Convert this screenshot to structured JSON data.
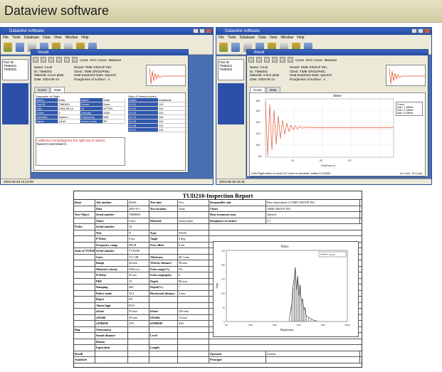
{
  "header": {
    "title": "Dataview software"
  },
  "screens": [
    {
      "app_title": "Dataview software",
      "menu": [
        "File",
        "Tools",
        "Database",
        "Data",
        "View",
        "Window",
        "Help"
      ],
      "dialog_title": "Result",
      "dialog_toolbar": [
        "Curve",
        "DAC Curve",
        "Measure"
      ],
      "info": [
        "Name:  Crust",
        "ID:  TIME001",
        "Material: Armor plate",
        "Date:  2004-06-14"
      ],
      "info_right": [
        "Result:  TIME GROUP INC.",
        "Client:  TIME GROUPINC.",
        "Heat treatment state:  Quench",
        "Roughness of surface:  .4"
      ],
      "tabs": [
        "Curve",
        "Data"
      ],
      "side_labels": [
        "Part ID",
        "TIME001",
        "TIME002"
      ],
      "params_title": "Parameter of Static",
      "params_cols": [
        "Name",
        "Data",
        "Name",
        "Data"
      ],
      "params": [
        [
          "Part ID",
          "TIME001",
          "Sense",
          "Data"
        ],
        [
          "Gain",
          "2004-06-14",
          "10",
          "ATTEN"
        ],
        [
          "Probe",
          "5",
          "Velocity",
          "4000"
        ],
        [
          "Operator",
          "System",
          "Frequency",
          "MID"
        ],
        [
          "Name",
          "18.40",
          "Active mode",
          "RF"
        ]
      ],
      "datalist_title": "Data of Sampled point",
      "datalist": [
        [
          "Depth",
          "Amplitude"
        ],
        [
          "01.01",
          "119"
        ],
        [
          "01.02",
          "119"
        ],
        [
          "01.03",
          "119"
        ],
        [
          "01.04",
          "119"
        ],
        [
          "01.05",
          "119"
        ],
        [
          "01.06",
          "119"
        ],
        [
          "01.07",
          "119"
        ]
      ],
      "note_label": "Additional remarks(press the right key to select)",
      "note_text": "Name:Crust  Detail 3 ..",
      "status": "2004-09-28 10:13:08"
    },
    {
      "app_title": "Dataview software",
      "menu": [
        "File",
        "Tools",
        "Database",
        "Data",
        "View",
        "Window",
        "Help"
      ],
      "dialog_title": "Result",
      "dialog_toolbar": [
        "Curve",
        "DAC Curve",
        "Measure"
      ],
      "info": [
        "Name:  Crust",
        "ID:  TIME001",
        "Material: Armor plate",
        "Date:  2004-06-14"
      ],
      "info_right": [
        "Result:  TIME GROUP INC.",
        "Client:  TIME GROUPINC.",
        "Heat treatment state:  Quench",
        "Roughness of surface:  .4"
      ],
      "tabs": [
        "Curve",
        "Data"
      ],
      "wave_title": "Wave",
      "legend": [
        "Curve",
        "DAC 1 Offset",
        "DAC 2 Offset",
        "DAC 3 Offset"
      ],
      "hint": "Click Right button to scroll it if \"zoom to windows\" button is DOWN",
      "hint_right": "(0.4 mm, 10.0 pct)",
      "status": "2004-09-28 10:33"
    }
  ],
  "report": {
    "title": "TUD210-Inspection Report",
    "rows": [
      [
        "Basic",
        "Job number",
        "20x06",
        "Test time",
        "Test",
        "Responsible unit",
        "Flaw department of TIME GROUP INC."
      ],
      [
        "",
        "Date",
        "2003-6-5",
        "Test location",
        "Time",
        "Client",
        "TIME GROUP INC."
      ],
      [
        "Test Object",
        "Serial number",
        "TIME001",
        "",
        "",
        "Heat treatment state",
        "Quench"
      ],
      [
        "",
        "Name",
        "Crust",
        "Material",
        "Armor plate",
        "Roughness of surface",
        "0.1"
      ],
      [
        "Probe",
        "Serial number",
        "16",
        "",
        "",
        "",
        ""
      ],
      [
        "",
        "Way",
        "N",
        "Type",
        "NA/05",
        "",
        ""
      ],
      [
        "",
        "P-Delay",
        "0 um",
        "Angle",
        "0 deg",
        "",
        ""
      ],
      [
        "",
        "Frequency range",
        "HIGH",
        "Zero offset",
        "0 um",
        "",
        ""
      ],
      [
        "State of TUD200",
        "Serial number",
        "TVD200",
        "",
        "",
        "",
        ""
      ],
      [
        "",
        "Gain",
        "31.5 dB",
        "Thickness",
        "48.1 mm",
        "",
        ""
      ],
      [
        "",
        "Range",
        "20 mm",
        "Velocity distance",
        "98 mm",
        "",
        ""
      ],
      [
        "",
        "Material velocity",
        "3920 m/s",
        "Echo range(%)",
        "0%",
        "",
        ""
      ],
      [
        "",
        "D-Delay",
        "20 um",
        "Echo range(pdx)",
        "0",
        "",
        ""
      ],
      [
        "",
        "PRF",
        "10",
        "Depth",
        "98 mm",
        "",
        ""
      ],
      [
        "",
        "Damping",
        "400",
        "Depth(%)",
        "*",
        "",
        ""
      ],
      [
        "",
        "Pulser mode",
        "ALL",
        "Horizontal distance",
        "0 mm",
        "",
        ""
      ],
      [
        "",
        "Reject",
        "0%",
        "",
        "",
        "",
        ""
      ],
      [
        "",
        "Alarm logic",
        "POS",
        "",
        "",
        "",
        ""
      ],
      [
        "",
        "aStart",
        "95 mm",
        "bStart",
        "236 mm",
        "",
        ""
      ],
      [
        "",
        "aWidth",
        "20 mm",
        "bWidth",
        "12 mm",
        "",
        ""
      ],
      [
        "",
        "aTHRSH",
        "25%",
        "bTHRSH",
        "44%",
        "",
        ""
      ],
      [
        "Bug",
        "Orientation",
        "",
        "",
        "",
        "",
        ""
      ],
      [
        "",
        "Sound distance",
        "",
        "Level",
        "",
        "Vertical",
        ""
      ],
      [
        "",
        "Ration",
        "",
        "",
        "",
        "",
        ""
      ],
      [
        "",
        "Equivalent",
        "",
        "Length",
        "",
        "High",
        "Grade"
      ],
      [
        "Result",
        "",
        "",
        "",
        "",
        "Operator",
        "System"
      ],
      [
        "Standard",
        "",
        "",
        "",
        "",
        "Principal",
        ""
      ]
    ],
    "chart_title": "Wave",
    "chart_legend": "Curve",
    "chart_xlabel": "Depth(mm)",
    "chart_ylabel": "Amp",
    "chart_xticks": [
      "0.0",
      "20.0",
      "40.0",
      "60.0",
      "80.0",
      "100.0"
    ],
    "chart_yticks": [
      "0",
      "50",
      "100",
      "150",
      "200",
      "250"
    ]
  },
  "chart_data": {
    "type": "line",
    "title": "Wave",
    "xlabel": "Depth(mm)",
    "ylabel": "Amp",
    "xlim": [
      0,
      100
    ],
    "ylim": [
      0,
      250
    ],
    "series": [
      {
        "name": "Curve",
        "x": [
          52,
          54,
          55,
          56,
          57,
          58,
          59,
          60,
          61,
          62,
          63,
          64,
          65,
          66,
          68,
          70,
          72,
          75
        ],
        "y": [
          10,
          60,
          120,
          150,
          190,
          110,
          160,
          90,
          130,
          70,
          80,
          40,
          50,
          20,
          15,
          10,
          5,
          2
        ]
      }
    ]
  },
  "colors": {
    "title_blue": "#234a9e",
    "grid_blue": "#2f58ad",
    "header_bg": "#d9d4ae",
    "wave_red": "#e05a3a"
  }
}
